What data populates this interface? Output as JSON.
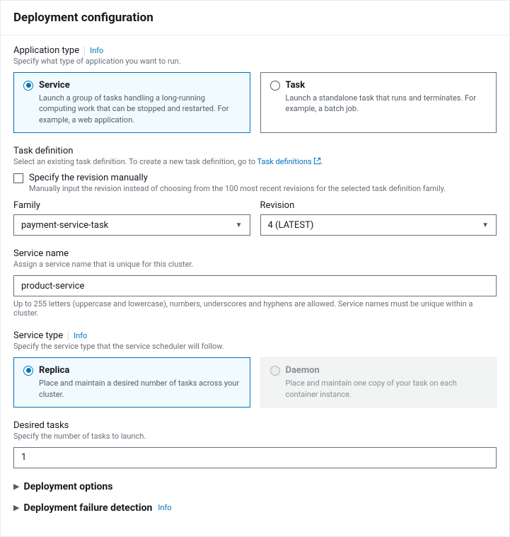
{
  "header": {
    "title": "Deployment configuration"
  },
  "appType": {
    "label": "Application type",
    "info": "Info",
    "desc": "Specify what type of application you want to run.",
    "options": [
      {
        "title": "Service",
        "desc": "Launch a group of tasks handling a long-running computing work that can be stopped and restarted. For example, a web application."
      },
      {
        "title": "Task",
        "desc": "Launch a standalone task that runs and terminates. For example, a batch job."
      }
    ]
  },
  "taskDef": {
    "label": "Task definition",
    "descPrefix": "Select an existing task definition. To create a new task definition, go to ",
    "link": "Task definitions",
    "checkbox": {
      "label": "Specify the revision manually",
      "desc": "Manually input the revision instead of choosing from the 100 most recent revisions for the selected task definition family."
    },
    "family": {
      "label": "Family",
      "value": "payment-service-task"
    },
    "revision": {
      "label": "Revision",
      "value": "4 (LATEST)"
    }
  },
  "serviceName": {
    "label": "Service name",
    "desc": "Assign a service name that is unique for this cluster.",
    "value": "product-service",
    "helper": "Up to 255 letters (uppercase and lowercase), numbers, underscores and hyphens are allowed. Service names must be unique within a cluster."
  },
  "serviceType": {
    "label": "Service type",
    "info": "Info",
    "desc": "Specify the service type that the service scheduler will follow.",
    "options": [
      {
        "title": "Replica",
        "desc": "Place and maintain a desired number of tasks across your cluster."
      },
      {
        "title": "Daemon",
        "desc": "Place and maintain one copy of your task on each container instance."
      }
    ]
  },
  "desiredTasks": {
    "label": "Desired tasks",
    "desc": "Specify the number of tasks to launch.",
    "value": "1"
  },
  "expandables": {
    "deploymentOptions": "Deployment options",
    "failureDetection": "Deployment failure detection",
    "info": "Info"
  }
}
